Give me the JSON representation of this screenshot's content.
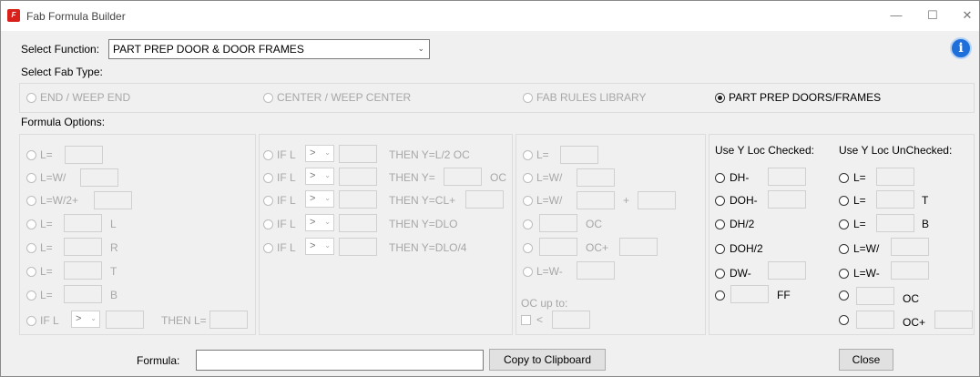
{
  "window": {
    "title": "Fab Formula Builder",
    "minimize": "—",
    "maximize": "☐",
    "close": "✕"
  },
  "select_function": {
    "label": "Select Function:",
    "value": "PART PREP DOOR & DOOR FRAMES"
  },
  "select_fab_type": {
    "label": "Select Fab Type:",
    "options": [
      "END / WEEP END",
      "CENTER / WEEP CENTER",
      "FAB RULES LIBRARY",
      "PART PREP DOORS/FRAMES"
    ],
    "selected": "PART PREP DOORS/FRAMES"
  },
  "formula_options": {
    "label": "Formula Options:"
  },
  "col1": {
    "rows": [
      {
        "pre": "L="
      },
      {
        "pre": "L=W/"
      },
      {
        "pre": "L=W/2+"
      },
      {
        "pre": "L=",
        "post": "L"
      },
      {
        "pre": "L=",
        "post": "R"
      },
      {
        "pre": "L=",
        "post": "T"
      },
      {
        "pre": "L=",
        "post": "B"
      }
    ],
    "ifl": {
      "pre": "IF L",
      "op": ">",
      "then": "THEN L="
    }
  },
  "col2": {
    "rows": [
      {
        "pre": "IF L",
        "op": ">",
        "then": "THEN Y=L/2 OC"
      },
      {
        "pre": "IF L",
        "op": ">",
        "then": "THEN Y=",
        "post": "OC"
      },
      {
        "pre": "IF L",
        "op": ">",
        "then": "THEN Y=CL+"
      },
      {
        "pre": "IF L",
        "op": ">",
        "then": "THEN Y=DLO"
      },
      {
        "pre": "IF L",
        "op": ">",
        "then": "THEN Y=DLO/4"
      }
    ]
  },
  "col3": {
    "rows": [
      {
        "pre": "L="
      },
      {
        "pre": "L=W/"
      },
      {
        "pre": "L=W/",
        "mid": "+"
      },
      {
        "post": "OC"
      },
      {
        "post": "OC+"
      },
      {
        "pre": "L=W-"
      }
    ],
    "oc_up_to": "OC up to:",
    "lt": "<"
  },
  "col4": {
    "header_checked": "Use Y Loc Checked:",
    "header_unchecked": "Use Y Loc UnChecked:",
    "checked": [
      "DH-",
      "DOH-",
      "DH/2",
      "DOH/2",
      "DW-",
      "FF"
    ],
    "unchecked": [
      {
        "pre": "L="
      },
      {
        "pre": "L=",
        "post": "T"
      },
      {
        "pre": "L=",
        "post": "B"
      },
      {
        "pre": "L=W/"
      },
      {
        "pre": "L=W-"
      },
      {
        "post": "OC"
      },
      {
        "post": "OC+"
      }
    ]
  },
  "formula": {
    "label": "Formula:",
    "value": ""
  },
  "buttons": {
    "copy": "Copy to Clipboard",
    "close": "Close"
  },
  "icons": {
    "info": "info-icon",
    "app": "app-icon"
  },
  "colors": {
    "accent": "#1e6fd9",
    "disabled_text": "#a7a7a7"
  }
}
